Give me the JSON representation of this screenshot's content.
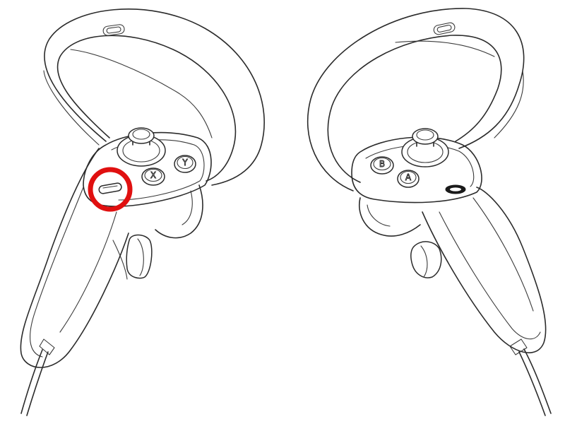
{
  "left_controller": {
    "button_labels": {
      "x": "X",
      "y": "Y"
    },
    "highlight": {
      "target": "menu-button",
      "color": "#e01010"
    }
  },
  "right_controller": {
    "button_labels": {
      "a": "A",
      "b": "B"
    }
  }
}
